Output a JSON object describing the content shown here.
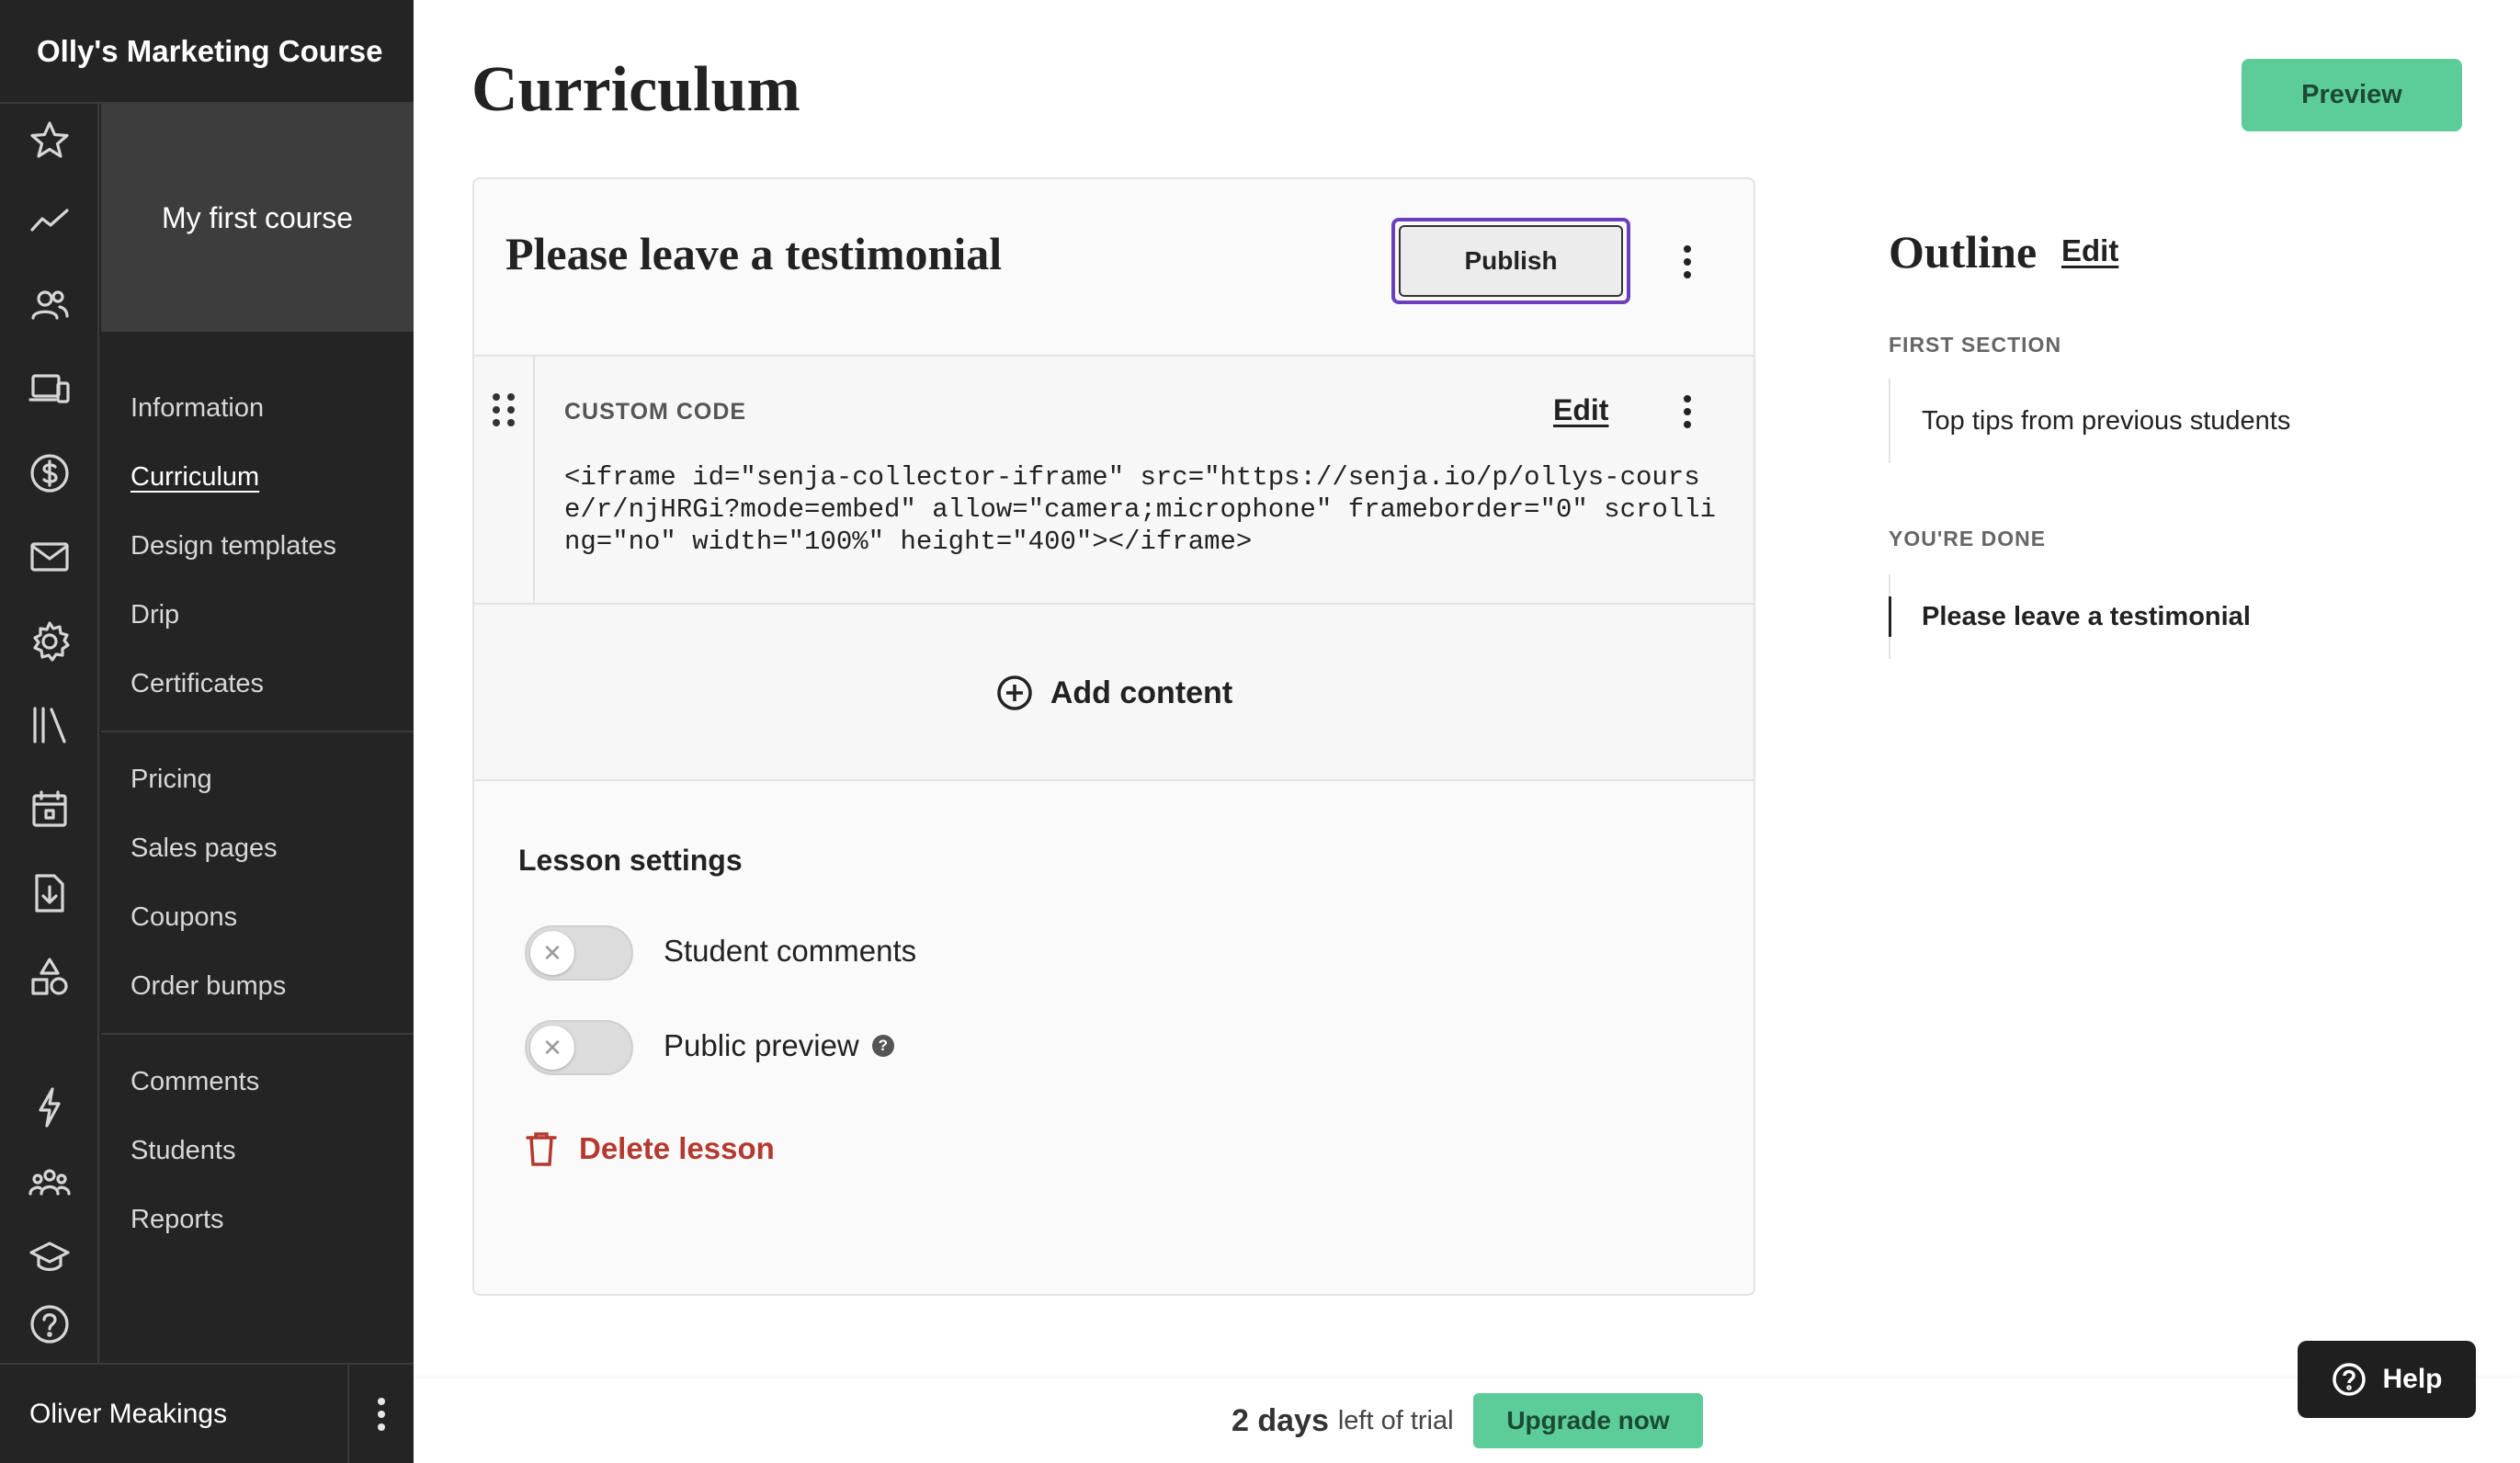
{
  "sidebar": {
    "school_name": "Olly's Marketing Course",
    "course_name": "My first course",
    "rail_icons": [
      "star-icon",
      "chart-line-icon",
      "users-icon",
      "devices-icon",
      "dollar-icon",
      "mail-icon",
      "gear-icon",
      "library-icon",
      "calendar-icon",
      "download-file-icon",
      "shapes-icon",
      "lightning-icon",
      "community-icon",
      "graduation-cap-icon",
      "help-circle-icon"
    ],
    "nav_group_1": [
      {
        "label": "Information"
      },
      {
        "label": "Curriculum",
        "active": true
      },
      {
        "label": "Design templates"
      },
      {
        "label": "Drip"
      },
      {
        "label": "Certificates"
      }
    ],
    "nav_group_2": [
      {
        "label": "Pricing"
      },
      {
        "label": "Sales pages"
      },
      {
        "label": "Coupons"
      },
      {
        "label": "Order bumps"
      }
    ],
    "nav_group_3": [
      {
        "label": "Comments"
      },
      {
        "label": "Students"
      },
      {
        "label": "Reports"
      }
    ],
    "user_name": "Oliver Meakings"
  },
  "header": {
    "title": "Curriculum",
    "preview_label": "Preview"
  },
  "lesson": {
    "title": "Please leave a testimonial",
    "publish_label": "Publish",
    "block": {
      "type_label": "CUSTOM CODE",
      "edit_label": "Edit",
      "code": "<iframe id=\"senja-collector-iframe\" src=\"https://senja.io/p/ollys-course/r/njHRGi?mode=embed\" allow=\"camera;microphone\" frameborder=\"0\" scrolling=\"no\" width=\"100%\" height=\"400\"></iframe>"
    },
    "add_content_label": "Add content",
    "settings": {
      "title": "Lesson settings",
      "student_comments_label": "Student comments",
      "student_comments_enabled": false,
      "public_preview_label": "Public preview",
      "public_preview_enabled": false,
      "delete_label": "Delete lesson"
    }
  },
  "outline": {
    "title": "Outline",
    "edit_label": "Edit",
    "sections": [
      {
        "label": "FIRST SECTION",
        "items": [
          "Top tips from previous students"
        ]
      },
      {
        "label": "YOU'RE DONE",
        "items": [
          "Please leave a testimonial"
        ]
      }
    ]
  },
  "trial": {
    "days": "2 days",
    "suffix": "left of trial",
    "upgrade_label": "Upgrade now"
  },
  "help_label": "Help",
  "colors": {
    "sidebar_bg": "#242424",
    "accent_green": "#5ccd98",
    "focus_purple": "#6b3fc0",
    "danger_red": "#b43a2f"
  }
}
